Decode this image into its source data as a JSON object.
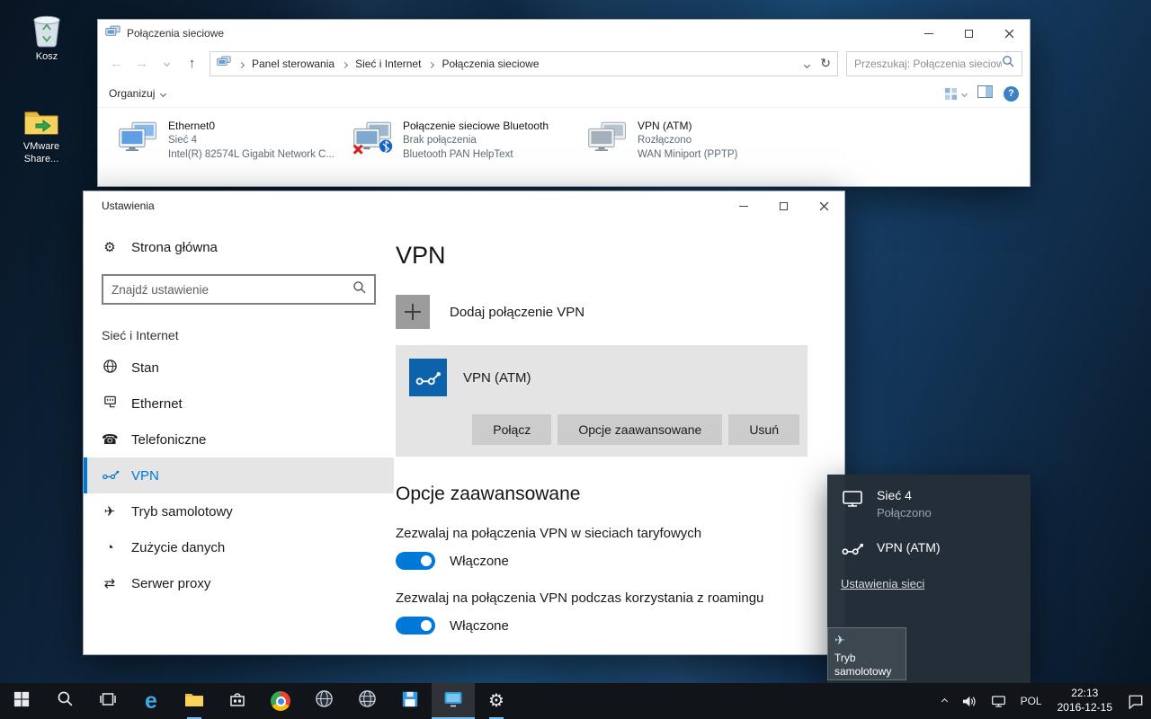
{
  "colors": {
    "accent": "#0078d7"
  },
  "icons": {
    "back_arrow": "←",
    "forward_arrow": "→",
    "up_arrow": "↑",
    "refresh": "↻",
    "gear": "⚙",
    "airplane": "✈",
    "phone": "☎",
    "data_usage": "◔",
    "proxy": "⇄",
    "help": "?",
    "edge": "e"
  },
  "desktop": {
    "icons": [
      {
        "label": "Kosz"
      },
      {
        "label": "VMware Share..."
      }
    ]
  },
  "explorer": {
    "title": "Połączenia sieciowe",
    "breadcrumb": [
      "Panel sterowania",
      "Sieć i Internet",
      "Połączenia sieciowe"
    ],
    "search_placeholder": "Przeszukaj: Połączenia sieciowe",
    "organize_label": "Organizuj",
    "items": [
      {
        "title": "Ethernet0",
        "status": "Sieć 4",
        "device": "Intel(R) 82574L Gigabit Network C..."
      },
      {
        "title": "Połączenie sieciowe Bluetooth",
        "status": "Brak połączenia",
        "device": "Bluetooth PAN HelpText"
      },
      {
        "title": "VPN (ATM)",
        "status": "Rozłączono",
        "device": "WAN Miniport (PPTP)"
      }
    ]
  },
  "settings": {
    "title": "Ustawienia",
    "home_label": "Strona główna",
    "search_placeholder": "Znajdź ustawienie",
    "group_label": "Sieć i Internet",
    "nav": [
      "Stan",
      "Ethernet",
      "Telefoniczne",
      "VPN",
      "Tryb samolotowy",
      "Zużycie danych",
      "Serwer proxy"
    ],
    "page": {
      "heading": "VPN",
      "add_label": "Dodaj połączenie VPN",
      "vpn_name": "VPN (ATM)",
      "connect": "Połącz",
      "advanced": "Opcje zaawansowane",
      "remove": "Usuń",
      "section_heading": "Opcje zaawansowane",
      "metered_label": "Zezwalaj na połączenia VPN w sieciach taryfowych",
      "metered_state": "Włączone",
      "roaming_label": "Zezwalaj na połączenia VPN podczas korzystania z roamingu",
      "roaming_state": "Włączone"
    }
  },
  "flyout": {
    "network_name": "Sieć 4",
    "network_status": "Połączono",
    "vpn_name": "VPN (ATM)",
    "settings_link": "Ustawienia sieci",
    "airplane_label": "Tryb samolotowy"
  },
  "taskbar": {
    "lang": "POL",
    "time": "22:13",
    "date": "2016-12-15"
  }
}
